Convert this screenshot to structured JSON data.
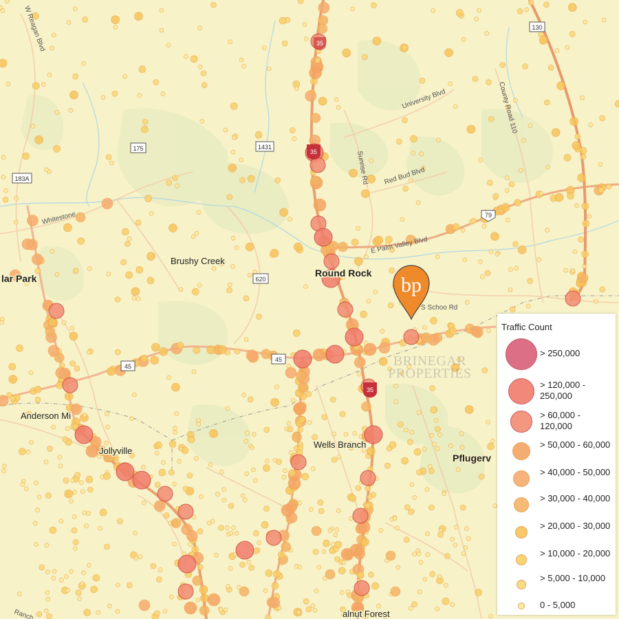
{
  "places": [
    {
      "id": "round-rock",
      "text": "Round Rock",
      "style": "big"
    },
    {
      "id": "brushy-creek",
      "text": "Brushy Creek",
      "style": "mid"
    },
    {
      "id": "cedar-park",
      "text": "lar Park",
      "style": "big"
    },
    {
      "id": "anderson-mill",
      "text": "Anderson Mi",
      "style": "mid"
    },
    {
      "id": "jollyville",
      "text": "Jollyville",
      "style": "mid"
    },
    {
      "id": "wells-branch",
      "text": "Wells Branch",
      "style": "mid"
    },
    {
      "id": "pflugerville",
      "text": "Pflugerv",
      "style": "big"
    },
    {
      "id": "walnut-forest",
      "text": "alnut Forest",
      "style": "mid"
    }
  ],
  "road_labels": [
    {
      "id": "reagan-blvd",
      "text": "W Reagan Blvd"
    },
    {
      "id": "university-blvd",
      "text": "University Blvd"
    },
    {
      "id": "county-road-110",
      "text": "County Road 110"
    },
    {
      "id": "sunrise-blvd",
      "text": "Sunrise Rd"
    },
    {
      "id": "eagles-blvd",
      "text": "Red Bud Blvd"
    },
    {
      "id": "whitestone",
      "text": "Whitestone"
    },
    {
      "id": "east-valley",
      "text": "E Palm Valley Blvd"
    },
    {
      "id": "school-rd",
      "text": "S Schoo Rd"
    },
    {
      "id": "ranch-rd",
      "text": "Ranch"
    }
  ],
  "shields": [
    {
      "id": "shield-130",
      "text": "130"
    },
    {
      "id": "shield-175",
      "text": "175"
    },
    {
      "id": "shield-1431",
      "text": "1431"
    },
    {
      "id": "shield-183a",
      "text": "183A"
    },
    {
      "id": "shield-620",
      "text": "620"
    },
    {
      "id": "shield-45",
      "text": "45"
    },
    {
      "id": "shield-45b",
      "text": "45"
    },
    {
      "id": "shield-79",
      "text": "79"
    },
    {
      "id": "shield-35a",
      "text": "35"
    },
    {
      "id": "shield-35b",
      "text": "35"
    },
    {
      "id": "shield-35c",
      "text": "35"
    }
  ],
  "legend": {
    "title": "Traffic Count",
    "classes": [
      {
        "label": "> 250,000",
        "color": "#d9607a"
      },
      {
        "label": "> 120,000 - 250,000",
        "color": "#f07c6c"
      },
      {
        "label": "> 60,000 - 120,000",
        "color": "#f28c74"
      },
      {
        "label": "> 50,000 - 60,000",
        "color": "#f5a463"
      },
      {
        "label": "> 40,000 - 50,000",
        "color": "#f6ab6d"
      },
      {
        "label": "> 30,000 - 40,000",
        "color": "#f4b465"
      },
      {
        "label": "> 20,000 - 30,000",
        "color": "#f7c45a"
      },
      {
        "label": "> 10,000 - 20,000",
        "color": "#f8d066"
      },
      {
        "label": "> 5,000 - 10,000",
        "color": "#f9d878"
      },
      {
        "label": "0 - 5,000",
        "color": "#fbeb9d"
      }
    ]
  },
  "watermark": {
    "line1": "BRINEGAR",
    "line2": "PROPERTIES"
  },
  "marker": {
    "monogram": "bp",
    "color": "#ef8a2a"
  },
  "colors": {
    "background": "#f7f2c8",
    "green": "#e9ebbf",
    "highway": "#e58b5b",
    "water": "#a9d6e8"
  }
}
